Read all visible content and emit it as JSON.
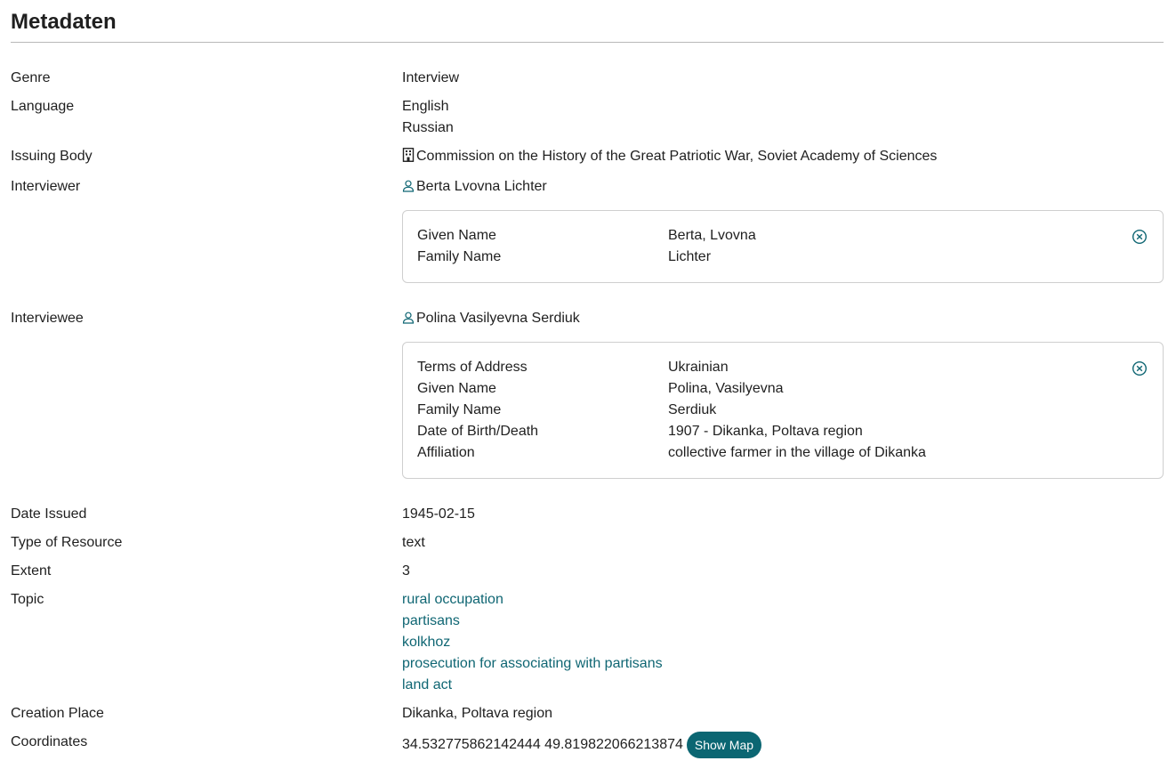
{
  "page": {
    "title": "Metadaten"
  },
  "fields": {
    "genre": {
      "label": "Genre",
      "value": "Interview"
    },
    "language": {
      "label": "Language",
      "values": [
        "English",
        "Russian"
      ]
    },
    "issuing_body": {
      "label": "Issuing Body",
      "value": "Commission on the History of the Great Patriotic War, Soviet Academy of Sciences",
      "icon": "building-icon"
    },
    "interviewer": {
      "label": "Interviewer",
      "value": "Berta Lvovna Lichter",
      "icon": "person-icon",
      "details": [
        {
          "k": "Given Name",
          "v": "Berta, Lvovna"
        },
        {
          "k": "Family Name",
          "v": "Lichter"
        }
      ]
    },
    "interviewee": {
      "label": "Interviewee",
      "value": "Polina Vasilyevna Serdiuk",
      "icon": "person-icon",
      "details": [
        {
          "k": "Terms of Address",
          "v": "Ukrainian"
        },
        {
          "k": "Given Name",
          "v": "Polina, Vasilyevna"
        },
        {
          "k": "Family Name",
          "v": "Serdiuk"
        },
        {
          "k": "Date of Birth/Death",
          "v": "1907 - Dikanka, Poltava region"
        },
        {
          "k": "Affiliation",
          "v": "collective farmer in the village of Dikanka"
        }
      ]
    },
    "date_issued": {
      "label": "Date Issued",
      "value": "1945-02-15"
    },
    "type_of_resource": {
      "label": "Type of Resource",
      "value": "text"
    },
    "extent": {
      "label": "Extent",
      "value": "3"
    },
    "topic": {
      "label": "Topic",
      "values": [
        "rural occupation",
        "partisans",
        "kolkhoz",
        "prosecution for associating with partisans",
        "land act"
      ]
    },
    "creation_place": {
      "label": "Creation Place",
      "value": "Dikanka, Poltava region"
    },
    "coordinates": {
      "label": "Coordinates",
      "value": "34.532775862142444 49.819822066213874",
      "button_label": "Show Map"
    }
  },
  "colors": {
    "link": "#0f6673",
    "button": "#0b6672"
  }
}
